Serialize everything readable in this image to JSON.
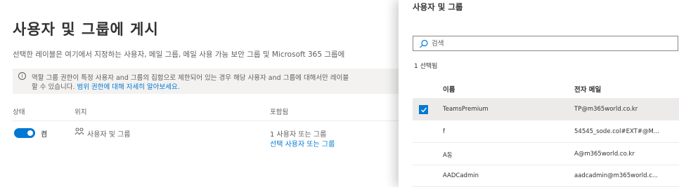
{
  "page": {
    "title": "사용자 및 그룹에 게시",
    "description": "선택한 레이블은 여기에서 지정하는 사용자, 메일 그룹, 메일 사용 가능 보안 그룹 및 Microsoft 365 그룹에",
    "info_line1": "역할 그룹 권한이 특정 사용자 and 그룹의 집합으로 제한되어 있는 경우 해당 사용자 and 그룹에 대해서만 레이블",
    "info_line2_prefix": "할 수 있습니다.",
    "info_link": "범위 권한에 대해 자세히 알아보세요.",
    "columns": {
      "status": "상태",
      "location": "위치",
      "included": "포함됨"
    },
    "row": {
      "status_label": "켬",
      "location_label": "사용자 및 그룹",
      "included_count": "1 사용자 또는 그룹",
      "included_link": "선택 사용자 또는 그룹"
    }
  },
  "panel": {
    "title": "사용자 및 그룹",
    "search_placeholder": "검색",
    "selected_count": "1 선택됨",
    "columns": {
      "name": "이름",
      "email": "전자 메일"
    },
    "rows": [
      {
        "name": "TeamsPremium",
        "email": "TP@m365world.co.kr",
        "selected": true
      },
      {
        "name": "f",
        "email": "54545_sode.col#EXT#@M...",
        "selected": false
      },
      {
        "name": "A동",
        "email": "A@m365world.co.kr",
        "selected": false
      },
      {
        "name": "AADCadmin",
        "email": "aadcadmin@m365world.c...",
        "selected": false
      }
    ]
  },
  "colors": {
    "accent": "#0078d4",
    "selected_row": "#edebe9"
  }
}
